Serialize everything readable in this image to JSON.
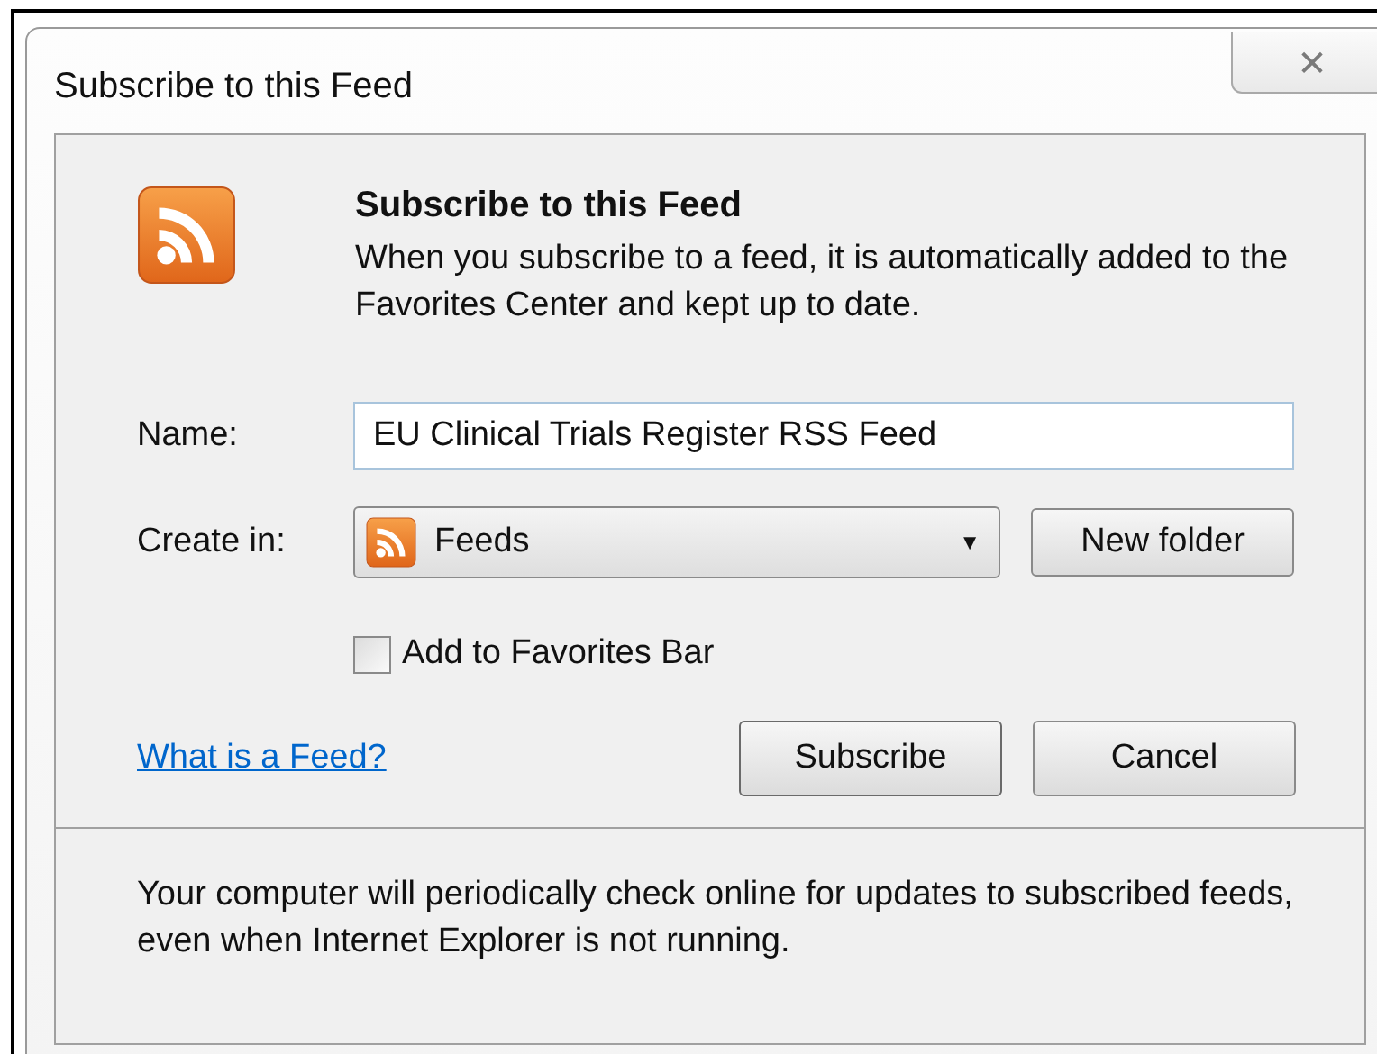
{
  "window": {
    "title": "Subscribe to this Feed",
    "close": "✕"
  },
  "header": {
    "title": "Subscribe to this Feed",
    "description": "When you subscribe to a feed, it is automatically added to the Favorites Center and kept up to date."
  },
  "name_field": {
    "label": "Name:",
    "value": "EU Clinical Trials Register RSS Feed"
  },
  "create_in": {
    "label": "Create in:",
    "value": "Feeds",
    "caret": "▼",
    "new_folder": "New folder"
  },
  "favorites_bar": {
    "label": "Add to Favorites Bar",
    "checked": false
  },
  "link": "What is a Feed?",
  "buttons": [
    {
      "label": "Subscribe",
      "kind": "default"
    },
    {
      "label": "Cancel",
      "kind": "normal"
    }
  ],
  "footer": "Your computer will periodically check online for updates to subscribed feeds, even when Internet Explorer is not running."
}
